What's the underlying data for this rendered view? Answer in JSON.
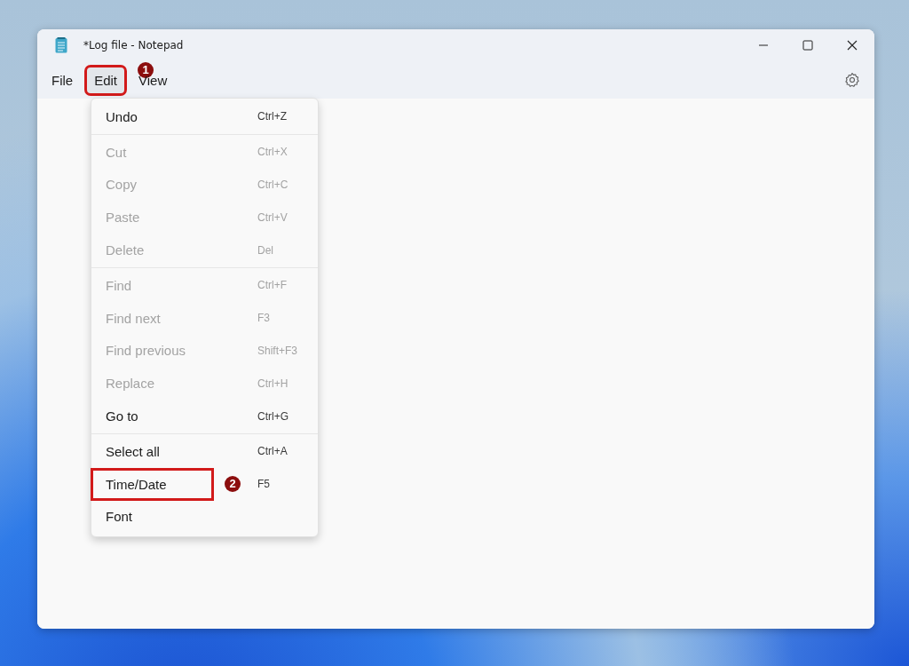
{
  "window": {
    "title": "*Log file - Notepad"
  },
  "menu_bar": [
    {
      "label": "File",
      "selected": false,
      "highlighted": false
    },
    {
      "label": "Edit",
      "selected": true,
      "highlighted": true,
      "badge": "1"
    },
    {
      "label": "View",
      "selected": false,
      "highlighted": false
    }
  ],
  "edit_menu": {
    "groups": [
      [
        {
          "label": "Undo",
          "shortcut": "Ctrl+Z",
          "disabled": false,
          "highlighted": false
        }
      ],
      [
        {
          "label": "Cut",
          "shortcut": "Ctrl+X",
          "disabled": true,
          "highlighted": false
        },
        {
          "label": "Copy",
          "shortcut": "Ctrl+C",
          "disabled": true,
          "highlighted": false
        },
        {
          "label": "Paste",
          "shortcut": "Ctrl+V",
          "disabled": true,
          "highlighted": false
        },
        {
          "label": "Delete",
          "shortcut": "Del",
          "disabled": true,
          "highlighted": false
        }
      ],
      [
        {
          "label": "Find",
          "shortcut": "Ctrl+F",
          "disabled": true,
          "highlighted": false
        },
        {
          "label": "Find next",
          "shortcut": "F3",
          "disabled": true,
          "highlighted": false
        },
        {
          "label": "Find previous",
          "shortcut": "Shift+F3",
          "disabled": true,
          "highlighted": false
        },
        {
          "label": "Replace",
          "shortcut": "Ctrl+H",
          "disabled": true,
          "highlighted": false
        },
        {
          "label": "Go to",
          "shortcut": "Ctrl+G",
          "disabled": false,
          "highlighted": false
        }
      ],
      [
        {
          "label": "Select all",
          "shortcut": "Ctrl+A",
          "disabled": false,
          "highlighted": false
        },
        {
          "label": "Time/Date",
          "shortcut": "F5",
          "disabled": false,
          "highlighted": true,
          "badge": "2"
        },
        {
          "label": "Font",
          "disabled": false,
          "highlighted": false
        }
      ]
    ]
  }
}
